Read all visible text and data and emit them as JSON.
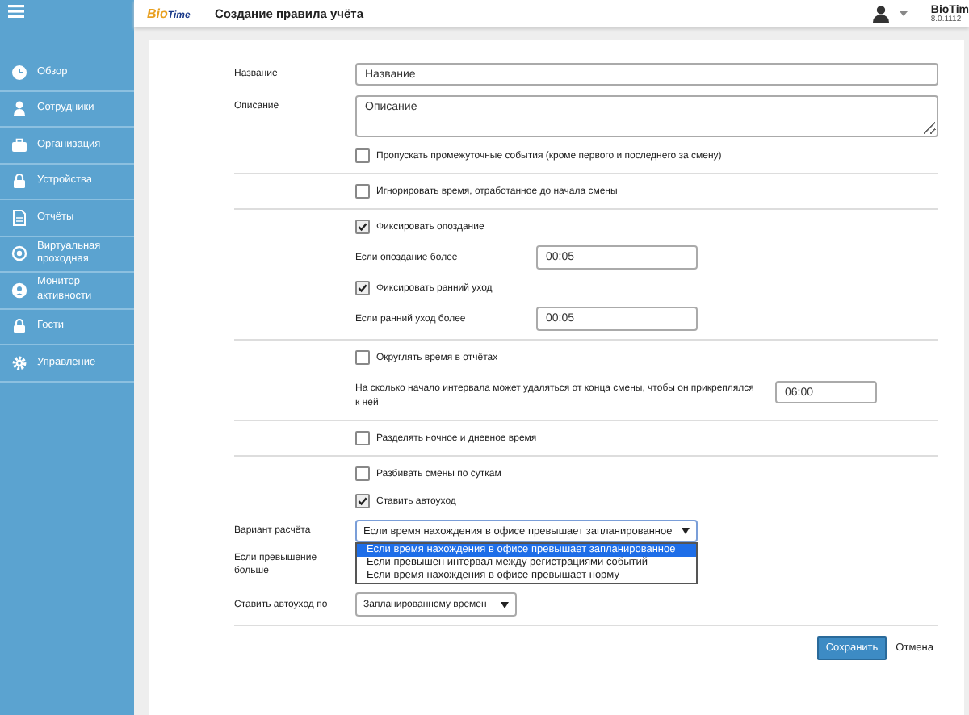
{
  "header": {
    "logo": [
      "Bio",
      "Time"
    ],
    "title": "Создание правила учёта",
    "app_name": "BioTim",
    "version": "8.0.1112"
  },
  "sidebar": {
    "items": [
      {
        "label": "Обзор"
      },
      {
        "label": "Сотрудники"
      },
      {
        "label": "Организация"
      },
      {
        "label": "Устройства"
      },
      {
        "label": "Отчёты"
      },
      {
        "label": "Виртуальная проходная"
      },
      {
        "label": "Монитор активности"
      },
      {
        "label": "Гости"
      },
      {
        "label": "Управление"
      }
    ]
  },
  "form": {
    "sections": [
      {
        "rows": [
          {
            "kind": "text",
            "label": "Название",
            "value": "Название"
          },
          {
            "kind": "textarea",
            "label": "Описание",
            "value": "Описание"
          },
          {
            "kind": "checkbox",
            "label": "Пропускать промежуточные события (кроме первого и последнего за смену)",
            "checked": false
          }
        ]
      },
      {
        "rows": [
          {
            "kind": "checkbox",
            "label": "Игнорировать время, отработанное до начала смены",
            "checked": false
          }
        ]
      },
      {
        "rows": [
          {
            "kind": "checkbox",
            "label": "Фиксировать опоздание",
            "checked": true
          },
          {
            "kind": "time",
            "label": "Если опоздание более",
            "value": "00:05"
          },
          {
            "kind": "checkbox",
            "label": "Фиксировать ранний уход",
            "checked": true
          },
          {
            "kind": "time",
            "label": "Если ранний уход более",
            "value": "00:05"
          }
        ]
      },
      {
        "rows": [
          {
            "kind": "checkbox",
            "label": "Округлять время в отчётах",
            "checked": false
          },
          {
            "kind": "wide-time",
            "label": "На сколько начало интервала может удаляться от конца смены, чтобы он прикреплялся к ней",
            "value": "06:00"
          }
        ]
      },
      {
        "rows": [
          {
            "kind": "checkbox",
            "label": "Разделять ночное и дневное время",
            "checked": false
          }
        ]
      },
      {
        "rows": [
          {
            "kind": "checkbox",
            "label": "Разбивать смены по суткам",
            "checked": false
          },
          {
            "kind": "checkbox",
            "label": "Ставить автоуход",
            "checked": true
          },
          {
            "kind": "select",
            "label": "Вариант расчёта",
            "value": "Если время нахождения в офисе превышает запланированное",
            "expanded": true,
            "options": [
              {
                "label": "Если время нахождения в офисе превышает запланированное",
                "selected": true
              },
              {
                "label": "Если превышен интервал между регистрациями событий",
                "selected": false
              },
              {
                "label": "Если время нахождения в офисе превышает норму",
                "selected": false
              }
            ]
          },
          {
            "kind": "label",
            "label": "Если превышение больше"
          },
          {
            "kind": "short-select",
            "label": "Ставить автоуход по",
            "value": "Запланированному времен",
            "expanded": false
          }
        ]
      }
    ],
    "buttons": [
      {
        "label": "Сохранить",
        "kind": "primary"
      },
      {
        "label": "Отмена",
        "kind": "link"
      }
    ]
  }
}
